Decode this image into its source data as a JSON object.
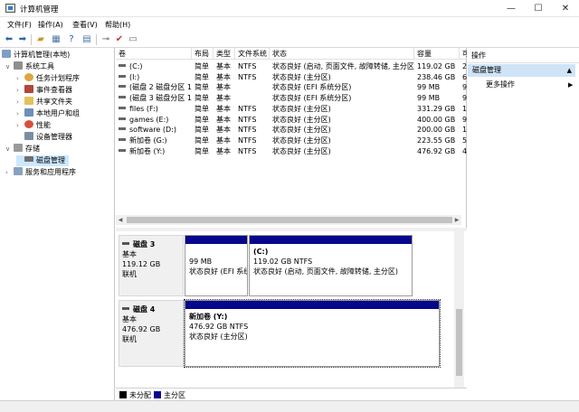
{
  "window": {
    "title": "计算机管理"
  },
  "menu": [
    "文件(F)",
    "操作(A)",
    "查看(V)",
    "帮助(H)"
  ],
  "tree": {
    "root": "计算机管理(本地)",
    "system_tools": "系统工具",
    "task_scheduler": "任务计划程序",
    "event_viewer": "事件查看器",
    "shared_folders": "共享文件夹",
    "local_users": "本地用户和组",
    "performance": "性能",
    "device_manager": "设备管理器",
    "storage": "存储",
    "disk_management": "磁盘管理",
    "services_apps": "服务和应用程序"
  },
  "volume_list": {
    "headers": {
      "volume": "卷",
      "layout": "布局",
      "type": "类型",
      "fs": "文件系统",
      "status": "状态",
      "capacity": "容量",
      "free": "可"
    },
    "rows": [
      {
        "volume": "(C:)",
        "layout": "简单",
        "type": "基本",
        "fs": "NTFS",
        "status": "状态良好 (启动, 页面文件, 故障转储, 主分区)",
        "capacity": "119.02 GB",
        "free": "2"
      },
      {
        "volume": "(I:)",
        "layout": "简单",
        "type": "基本",
        "fs": "NTFS",
        "status": "状态良好 (主分区)",
        "capacity": "238.46 GB",
        "free": "6"
      },
      {
        "volume": "(磁盘 2 磁盘分区 1)",
        "layout": "简单",
        "type": "基本",
        "fs": "",
        "status": "状态良好 (EFI 系统分区)",
        "capacity": "99 MB",
        "free": "9"
      },
      {
        "volume": "(磁盘 3 磁盘分区 1)",
        "layout": "简单",
        "type": "基本",
        "fs": "",
        "status": "状态良好 (EFI 系统分区)",
        "capacity": "99 MB",
        "free": "9"
      },
      {
        "volume": "files (F:)",
        "layout": "简单",
        "type": "基本",
        "fs": "NTFS",
        "status": "状态良好 (主分区)",
        "capacity": "331.29 GB",
        "free": "1"
      },
      {
        "volume": "games (E:)",
        "layout": "简单",
        "type": "基本",
        "fs": "NTFS",
        "status": "状态良好 (主分区)",
        "capacity": "400.00 GB",
        "free": "9"
      },
      {
        "volume": "software (D:)",
        "layout": "简单",
        "type": "基本",
        "fs": "NTFS",
        "status": "状态良好 (主分区)",
        "capacity": "200.00 GB",
        "free": "1"
      },
      {
        "volume": "新加卷 (G:)",
        "layout": "简单",
        "type": "基本",
        "fs": "NTFS",
        "status": "状态良好 (主分区)",
        "capacity": "223.55 GB",
        "free": "5"
      },
      {
        "volume": "新加卷 (Y:)",
        "layout": "简单",
        "type": "基本",
        "fs": "NTFS",
        "status": "状态良好 (主分区)",
        "capacity": "476.92 GB",
        "free": "4"
      }
    ]
  },
  "disks": [
    {
      "name": "磁盘 3",
      "kind": "基本",
      "size": "119.12 GB",
      "state": "联机",
      "partitions": [
        {
          "label": "",
          "size": "99 MB",
          "status": "状态良好 (EFI 系统"
        },
        {
          "label": "(C:)",
          "size": "119.02 GB NTFS",
          "status": "状态良好 (启动, 页面文件, 故障转储, 主分区)"
        }
      ]
    },
    {
      "name": "磁盘 4",
      "kind": "基本",
      "size": "476.92 GB",
      "state": "联机",
      "partitions": [
        {
          "label": "新加卷 (Y:)",
          "size": "476.92 GB NTFS",
          "status": "状态良好 (主分区)"
        }
      ]
    }
  ],
  "legend": {
    "unallocated": "未分配",
    "primary": "主分区"
  },
  "actions": {
    "title": "操作",
    "section": "磁盘管理",
    "more": "更多操作"
  },
  "colors": {
    "primary_partition": "#07078c",
    "unallocated": "#000000",
    "selection": "#cce8ff"
  }
}
